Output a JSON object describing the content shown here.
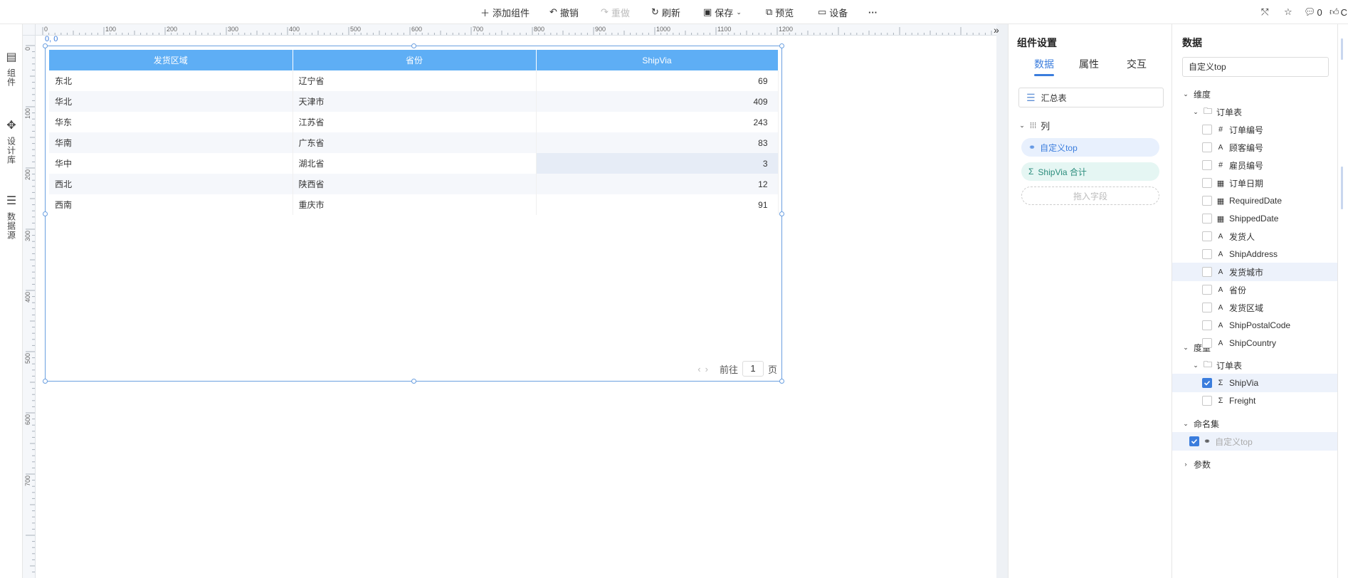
{
  "toolbar": {
    "add": "添加组件",
    "undo": "撤销",
    "redo": "重做",
    "refresh": "刷新",
    "save": "保存",
    "preview": "预览",
    "device": "设备",
    "more": "···",
    "comment_count": "0",
    "like_label": "C"
  },
  "left_rail": {
    "components": "组件",
    "design_lib": "设计库",
    "data_source": "数据源"
  },
  "ruler": {
    "top_ticks": [
      "0",
      "100",
      "200",
      "300",
      "400",
      "500",
      "600",
      "700",
      "800",
      "900",
      "1000",
      "1100",
      "1200"
    ],
    "left_ticks": [
      "0",
      "100",
      "200",
      "300",
      "400",
      "500",
      "600",
      "700"
    ]
  },
  "canvas": {
    "coord": "0, 0"
  },
  "table": {
    "columns": [
      "发货区域",
      "省份",
      "ShipVia"
    ],
    "rows": [
      {
        "region": "东北",
        "province": "辽宁省",
        "shipvia": "69"
      },
      {
        "region": "华北",
        "province": "天津市",
        "shipvia": "409"
      },
      {
        "region": "华东",
        "province": "江苏省",
        "shipvia": "243"
      },
      {
        "region": "华南",
        "province": "广东省",
        "shipvia": "83"
      },
      {
        "region": "华中",
        "province": "湖北省",
        "shipvia": "3"
      },
      {
        "region": "西北",
        "province": "陕西省",
        "shipvia": "12"
      },
      {
        "region": "西南",
        "province": "重庆市",
        "shipvia": "91"
      }
    ],
    "pager": {
      "goto": "前往",
      "page": "1",
      "page_unit": "页"
    }
  },
  "settings": {
    "title": "组件设置",
    "tabs": [
      "数据",
      "属性",
      "交互"
    ],
    "chart_type": "汇总表",
    "section_label": "列",
    "pill_custom": "自定义top",
    "pill_sum": "ShipVia 合计",
    "drop_hint": "拖入字段"
  },
  "data_panel": {
    "title": "数据",
    "search_value": "自定义top",
    "dimension_label": "维度",
    "dimension_table": "订单表",
    "dimension_fields": [
      {
        "name": "订单编号",
        "type": "#"
      },
      {
        "name": "顾客编号",
        "type": "Ab"
      },
      {
        "name": "雇员编号",
        "type": "#"
      },
      {
        "name": "订单日期",
        "type": "date"
      },
      {
        "name": "RequiredDate",
        "type": "date"
      },
      {
        "name": "ShippedDate",
        "type": "date"
      },
      {
        "name": "发货人",
        "type": "Ab"
      },
      {
        "name": "ShipAddress",
        "type": "Ab"
      },
      {
        "name": "发货城市",
        "type": "Ab"
      },
      {
        "name": "省份",
        "type": "Ab"
      },
      {
        "name": "发货区域",
        "type": "Ab"
      },
      {
        "name": "ShipPostalCode",
        "type": "Ab"
      },
      {
        "name": "ShipCountry",
        "type": "Ab"
      }
    ],
    "measure_label": "度量",
    "measure_table": "订单表",
    "measure_fields": [
      {
        "name": "ShipVia",
        "checked": true
      },
      {
        "name": "Freight",
        "checked": false
      }
    ],
    "named_set_label": "命名集",
    "named_set_item": "自定义top",
    "params_label": "参数"
  },
  "colors": {
    "accent": "#3b7ddd",
    "table_header": "#5eaef5"
  }
}
